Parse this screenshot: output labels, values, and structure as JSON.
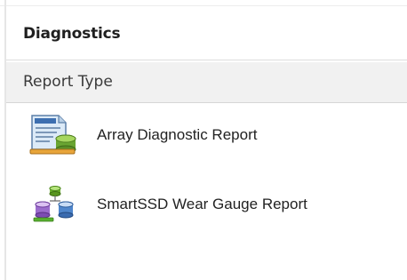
{
  "panel": {
    "title": "Diagnostics"
  },
  "section": {
    "title": "Report Type"
  },
  "reports": [
    {
      "label": "Array Diagnostic Report",
      "icon": "array-diagnostic-report-icon"
    },
    {
      "label": "SmartSSD Wear Gauge Report",
      "icon": "smartssd-wear-gauge-icon"
    }
  ],
  "colors": {
    "section_background": "#f1f1f1",
    "border": "#dcdcdc",
    "text": "#222222"
  }
}
